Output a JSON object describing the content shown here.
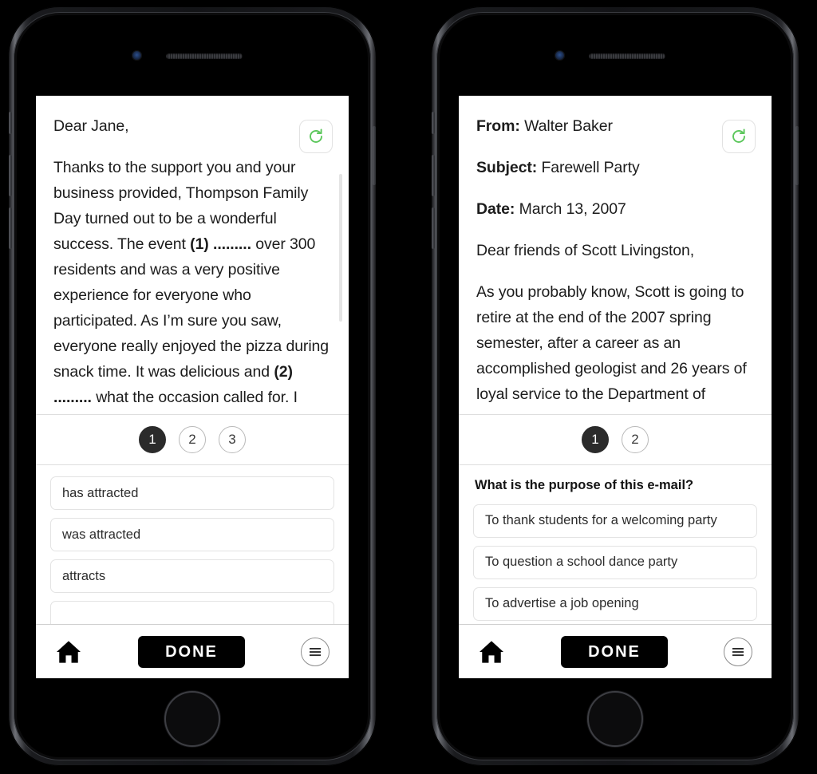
{
  "phones": [
    {
      "id": "left",
      "passage": {
        "greeting": "Dear Jane,",
        "body_before_1": "Thanks to the support you and your business provided, Thompson Family Day turned out to be a wonderful success. The event ",
        "blank_1": "(1) .........",
        "body_between": " over 300 residents and was a very positive experience for everyone who participated. As I’m sure you saw, everyone really enjoyed the pizza during snack time. It was delicious and ",
        "blank_2": "(2) .........",
        "body_after_2": " what the occasion called for. I hope that"
      },
      "refresh_icon": "refresh-icon",
      "pager": {
        "items": [
          "1",
          "2",
          "3"
        ],
        "active_index": 0
      },
      "question": "",
      "options": [
        "has attracted",
        "was attracted",
        "attracts",
        ""
      ],
      "toolbar": {
        "home_icon": "home-icon",
        "done_label": "DONE",
        "menu_icon": "hamburger-menu-icon"
      }
    },
    {
      "id": "right",
      "passage": {
        "from_label": "From:",
        "from_value": " Walter Baker",
        "subject_label": "Subject:",
        "subject_value": " Farewell Party",
        "date_label": "Date:",
        "date_value": " March 13, 2007",
        "salutation": "Dear friends of Scott Livingston,",
        "body": "As you probably know, Scott is going to retire at the end of the 2007 spring semester, after a career as an accomplished geologist and 26 years of loyal service to the Department of"
      },
      "refresh_icon": "refresh-icon",
      "pager": {
        "items": [
          "1",
          "2"
        ],
        "active_index": 0
      },
      "question": "What is the purpose of this e-mail?",
      "options": [
        "To thank students for a welcoming party",
        "To question a school dance party",
        "To advertise a job opening"
      ],
      "toolbar": {
        "home_icon": "home-icon",
        "done_label": "DONE",
        "menu_icon": "hamburger-menu-icon"
      }
    }
  ],
  "colors": {
    "accent_green": "#5cc75c",
    "active_dot": "#2b2b2b",
    "done_button": "#000000",
    "background": "#000000"
  }
}
